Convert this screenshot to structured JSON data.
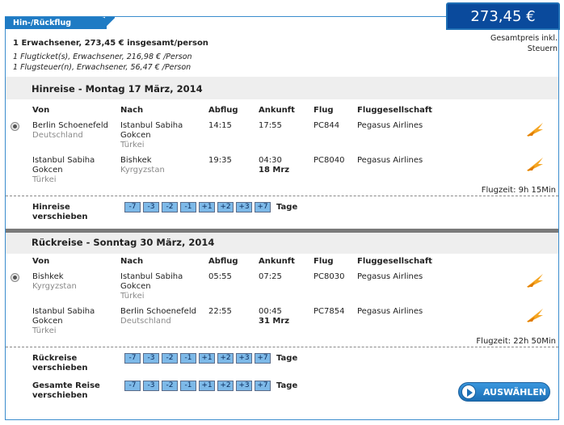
{
  "tab_label": "Hin-/Rückflug",
  "total_price": "273,45 €",
  "price_note_line1": "Gesamtpreis inkl.",
  "price_note_line2": "Steuern",
  "summary": {
    "line1": "1 Erwachsener, 273,45 € insgesamt/person",
    "line2": "1 Flugticket(s), Erwachsener, 216,98 € /Person",
    "line3": "1 Flugsteuer(n), Erwachsener, 56,47 € /Person"
  },
  "columns": {
    "von": "Von",
    "nach": "Nach",
    "abflug": "Abflug",
    "ankunft": "Ankunft",
    "flug": "Flug",
    "airline": "Fluggesellschaft"
  },
  "outbound": {
    "title": "Hinreise - Montag 17 März, 2014",
    "seg1": {
      "from_city": "Berlin Schoenefeld",
      "from_country": "Deutschland",
      "to_city1": "Istanbul Sabiha",
      "to_city2": "Gokcen",
      "to_country": "Türkei",
      "dep": "14:15",
      "arr": "17:55",
      "flight": "PC844",
      "airline": "Pegasus Airlines"
    },
    "seg2": {
      "from_city1": "Istanbul Sabiha",
      "from_city2": "Gokcen",
      "from_country": "Türkei",
      "to_city": "Bishkek",
      "to_country": "Kyrgyzstan",
      "dep": "19:35",
      "arr": "04:30",
      "arr_date": "18 Mrz",
      "flight": "PC8040",
      "airline": "Pegasus Airlines"
    },
    "flight_time": "Flugzeit: 9h 15Min",
    "shift_label1": "Hinreise",
    "shift_label2": "verschieben"
  },
  "return": {
    "title": "Rückreise - Sonntag 30 März, 2014",
    "seg1": {
      "from_city": "Bishkek",
      "from_country": "Kyrgyzstan",
      "to_city1": "Istanbul Sabiha",
      "to_city2": "Gokcen",
      "to_country": "Türkei",
      "dep": "05:55",
      "arr": "07:25",
      "flight": "PC8030",
      "airline": "Pegasus Airlines"
    },
    "seg2": {
      "from_city1": "Istanbul Sabiha",
      "from_city2": "Gokcen",
      "from_country": "Türkei",
      "to_city": "Berlin Schoenefeld",
      "to_country": "Deutschland",
      "dep": "22:55",
      "arr": "00:45",
      "arr_date": "31 Mrz",
      "flight": "PC7854",
      "airline": "Pegasus Airlines"
    },
    "flight_time": "Flugzeit: 22h 50Min",
    "shift_label1": "Rückreise",
    "shift_label2": "verschieben"
  },
  "total_shift_label1": "Gesamte Reise",
  "total_shift_label2": "verschieben",
  "shift_buttons": [
    "-7",
    "-3",
    "-2",
    "-1",
    "+1",
    "+2",
    "+3",
    "+7"
  ],
  "days_label": "Tage",
  "select_button": "AUSWÄHLEN",
  "colors": {
    "brand_blue": "#0a4a9c",
    "airline_logo": "#f5a623"
  }
}
